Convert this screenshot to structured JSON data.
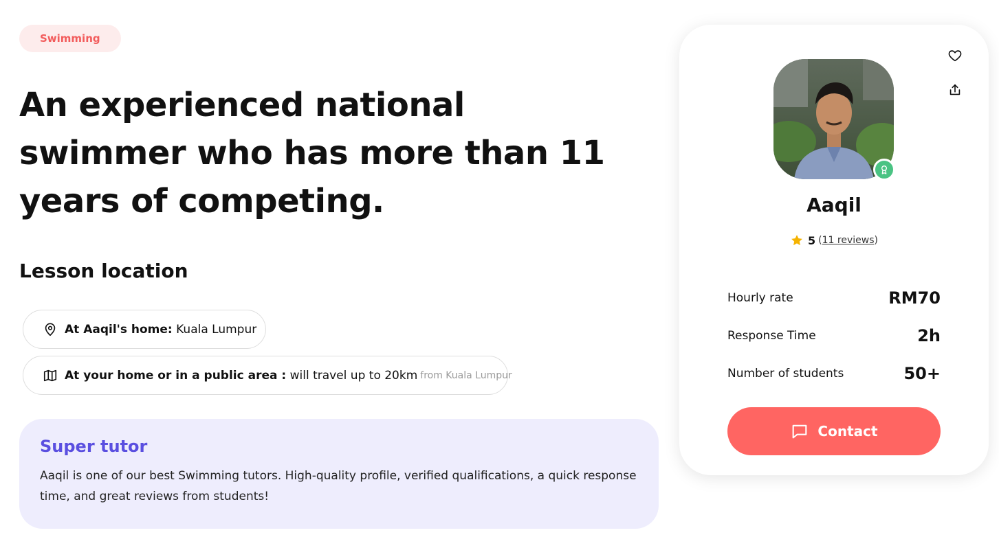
{
  "category": "Swimming",
  "headline": "An experienced national swimmer who has more than 11 years of competing.",
  "lesson_location": {
    "title": "Lesson location",
    "items": [
      {
        "icon": "map-pin-icon",
        "bold": "At Aaqil's home:",
        "text": " Kuala Lumpur",
        "muted": ""
      },
      {
        "icon": "map-icon",
        "bold": "At your home or in a public area :",
        "text": " will travel up to 20km",
        "muted": "from Kuala Lumpur"
      }
    ]
  },
  "super_tutor": {
    "title": "Super tutor",
    "description": "Aaqil is one of our best Swimming tutors. High-quality profile, verified qualifications, a quick response time, and great reviews from students!"
  },
  "card": {
    "name": "Aaqil",
    "rating": "5",
    "reviews_open": "(",
    "reviews_text": "11 reviews",
    "reviews_close": ")",
    "stats": [
      {
        "label": "Hourly rate",
        "value": "RM70"
      },
      {
        "label": "Response Time",
        "value": "2h"
      },
      {
        "label": "Number of students",
        "value": "50+"
      }
    ],
    "contact_label": "Contact"
  },
  "colors": {
    "accent": "#ff6562",
    "pill_text": "#f25c5c",
    "super_tutor_bg": "#eeedfd",
    "super_tutor_title": "#5a4fe0",
    "badge": "#4ac383",
    "star": "#f5b301"
  }
}
